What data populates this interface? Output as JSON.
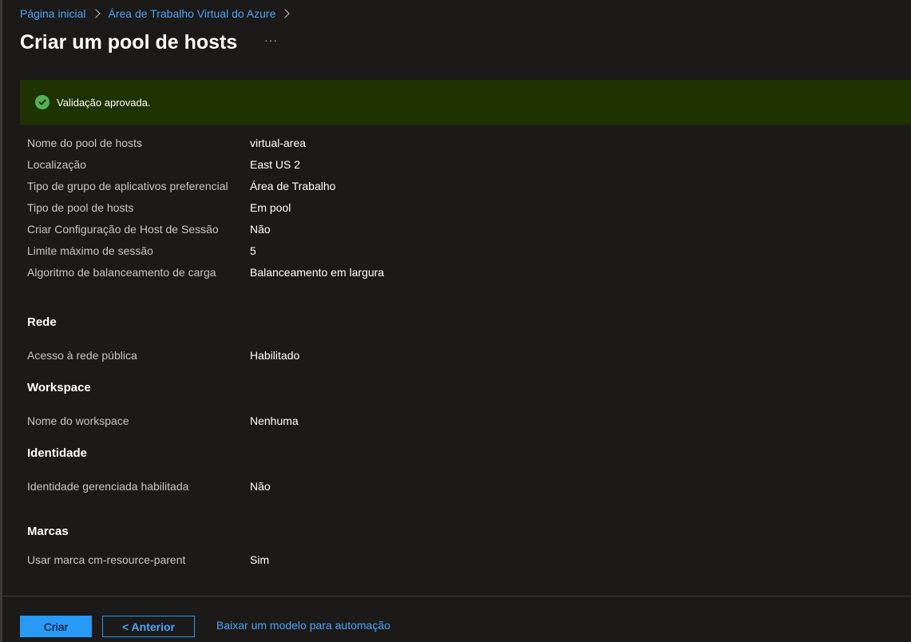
{
  "breadcrumb": {
    "items": [
      {
        "label": "Página inicial"
      },
      {
        "label": "Área de Trabalho Virtual do Azure"
      }
    ]
  },
  "page": {
    "title": "Criar um pool de hosts",
    "more_label": "···"
  },
  "banner": {
    "message": "Validação aprovada.",
    "icon": "checkmark-circle-icon",
    "color": "#1f3300",
    "icon_color": "#54b054"
  },
  "basics": [
    {
      "label": "Nome do pool de hosts",
      "value": "virtual-area"
    },
    {
      "label": "Localização",
      "value": "East US 2"
    },
    {
      "label": "Tipo de grupo de aplicativos preferencial",
      "value": "Área de Trabalho"
    },
    {
      "label": "Tipo de pool de hosts",
      "value": "Em pool"
    },
    {
      "label": "Criar Configuração de Host de Sessão",
      "value": "Não"
    },
    {
      "label": "Limite máximo de sessão",
      "value": "5"
    },
    {
      "label": "Algoritmo de balanceamento de carga",
      "value": "Balanceamento em largura"
    }
  ],
  "sections": {
    "rede": {
      "heading": "Rede",
      "rows": [
        {
          "label": "Acesso à rede pública",
          "value": "Habilitado"
        }
      ]
    },
    "workspace": {
      "heading": "Workspace",
      "rows": [
        {
          "label": "Nome do workspace",
          "value": "Nenhuma"
        }
      ]
    },
    "identidade": {
      "heading": "Identidade",
      "rows": [
        {
          "label": "Identidade gerenciada habilitada",
          "value": "Não"
        }
      ]
    },
    "marcas": {
      "heading": "Marcas",
      "rows": [
        {
          "label": "Usar marca cm-resource-parent",
          "value": "Sim"
        }
      ]
    }
  },
  "footer": {
    "create_label": "Criar",
    "previous_label": "< Anterior",
    "download_label": "Baixar um modelo para automação"
  },
  "colors": {
    "accent": "#2899f5",
    "link": "#4ea4f6",
    "background": "#1b1a19"
  }
}
